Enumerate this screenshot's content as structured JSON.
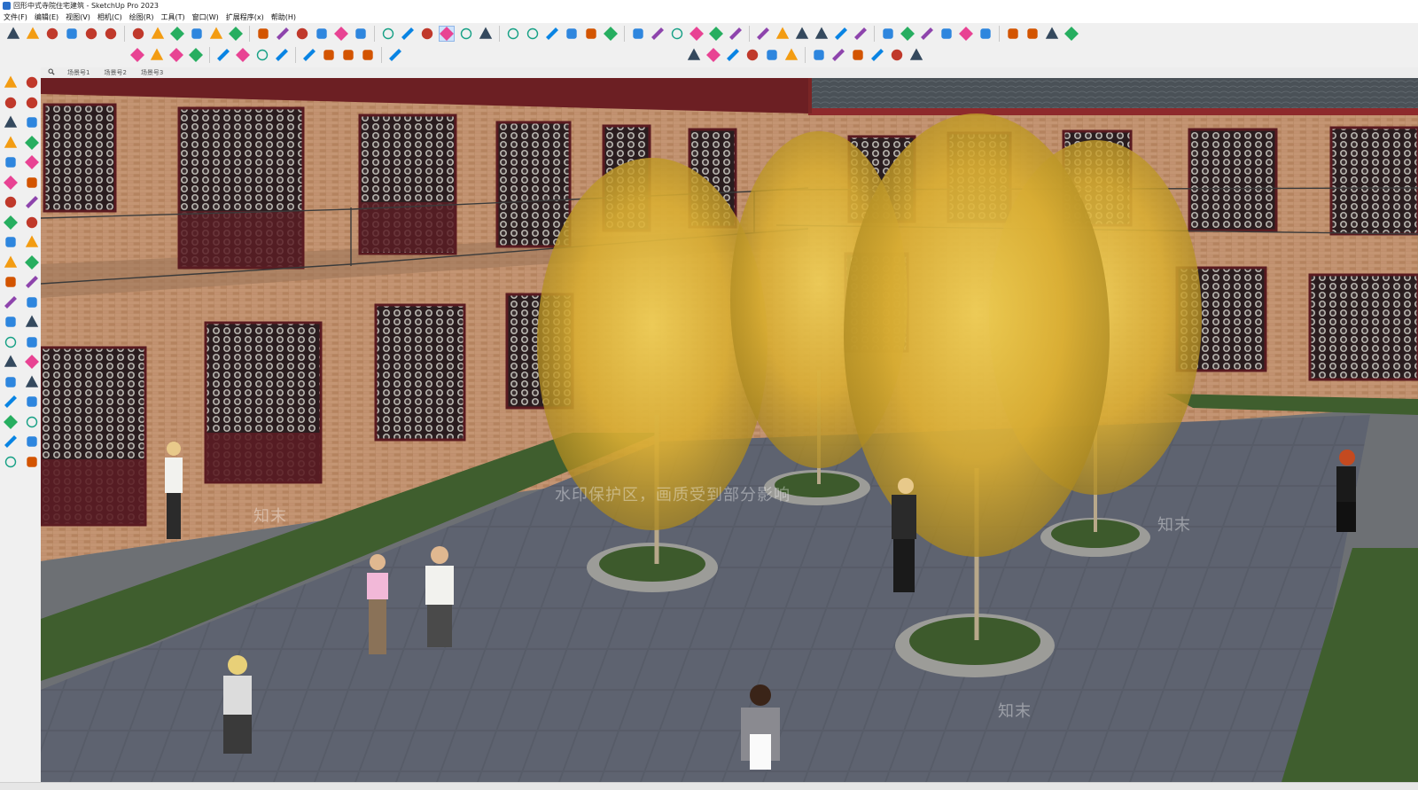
{
  "window": {
    "title": "回形中式寺院住宅建筑 - SketchUp Pro 2023"
  },
  "menu": [
    "文件(F)",
    "编辑(E)",
    "视图(V)",
    "相机(C)",
    "绘图(R)",
    "工具(T)",
    "窗口(W)",
    "扩展程序(x)",
    "帮助(H)"
  ],
  "scene_tabs": [
    "场景号1",
    "场景号2",
    "场景号3"
  ],
  "watermark": {
    "text": "水印保护区，画质受到部分影响",
    "logo": "知末"
  },
  "colors": {
    "accent": "#3c7fd6",
    "brick": "#b88866",
    "roof": "#4a5258",
    "timber": "#6b2128",
    "foliage": "#d9b13a",
    "paving": "#5a5f6b",
    "grass": "#3f5e2e"
  },
  "toolbar_top": [
    "zoom-icon",
    "select-icon",
    "eraser-icon",
    "pencil-icon",
    "arc-icon",
    "paint-icon",
    "push-pull-icon",
    "follow-me-icon",
    "move-icon",
    "rotate-icon",
    "scale-icon",
    "offset-icon",
    "tape-icon",
    "protractor-icon",
    "orbit-icon",
    "pan-icon",
    "zoom-window-icon",
    "zoom-extents-icon",
    "section-icon",
    "sandbox-icon",
    "layers-icon",
    "tag-icon",
    "user-icon",
    "component-icon",
    "group-icon",
    "iso-view-icon",
    "top-view-icon",
    "front-view-icon",
    "right-view-icon",
    "back-view-icon",
    "left-view-icon",
    "folder-icon",
    "settings-icon",
    "close-icon",
    "style-icon",
    "shadow-icon",
    "fog-icon",
    "xray-icon",
    "wire-icon",
    "shaded-icon",
    "cloud-icon",
    "cloud-down-icon",
    "warehouse-icon",
    "dot-icon",
    "dimension-icon",
    "solid-union-icon",
    "solid-subtract-icon",
    "solid-intersect-icon",
    "solid-trim-icon",
    "solid-split-icon",
    "cloud-upload-icon",
    "cloud-sync-icon"
  ],
  "toolbar_second": [
    "visibility-icon",
    "scene-icon",
    "outliner-icon",
    "add-location-icon",
    "geo-icon",
    "chart-icon",
    "checker-icon",
    "cloud-icon",
    "gear-icon",
    "export-icon",
    "info-icon",
    "cart-icon",
    "account-icon"
  ],
  "toolbar_third": [
    "style-1-icon",
    "style-2-icon",
    "style-3-icon",
    "style-4-icon",
    "style-5-icon",
    "style-6-icon",
    "print-icon",
    "layout-icon",
    "window-icon",
    "window-2-icon",
    "window-3-icon",
    "lock-icon"
  ],
  "left_tools": [
    "select-icon",
    "orbit-icon",
    "paint-icon",
    "eraser-icon",
    "component-icon",
    "pencil-icon",
    "line-icon",
    "freehand-icon",
    "rectangle-icon",
    "rotated-rect-icon",
    "circle-icon",
    "polygon-icon",
    "arc-icon",
    "pie-icon",
    "move-icon",
    "push-pull-icon",
    "rotate-icon",
    "follow-me-icon",
    "scale-icon",
    "offset-icon",
    "tape-icon",
    "dimension-icon",
    "protractor-icon",
    "text-icon",
    "axes-icon",
    "3d-text-icon",
    "orbit-2-icon",
    "pan-icon",
    "zoom-icon",
    "zoom-window-icon",
    "zoom-extents-icon",
    "previous-icon",
    "position-camera-icon",
    "walk-icon",
    "look-around-icon",
    "section-icon",
    "sandbox-icon",
    "smoove-icon",
    "stamp-icon",
    "drape-icon"
  ]
}
